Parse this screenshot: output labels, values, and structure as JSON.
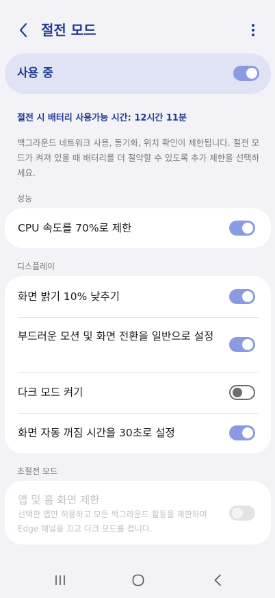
{
  "header": {
    "title": "절전 모드"
  },
  "master": {
    "label": "사용 중",
    "enabled": true
  },
  "battery_time": "절전 시 배터리 사용가능 시간: 12시간 11분",
  "description": "백그라운드 네트워크 사용, 동기화, 위치 확인이 제한됩니다. 절전 모드가 켜져 있을 때 배터리를 더 절약할 수 있도록 추가 제한을 선택하세요.",
  "sections": {
    "performance": {
      "label": "성능",
      "items": [
        {
          "label": "CPU 속도를 70%로 제한",
          "enabled": true
        }
      ]
    },
    "display": {
      "label": "디스플레이",
      "items": [
        {
          "label": "화면 밝기 10% 낮추기",
          "enabled": true
        },
        {
          "label": "부드러운 모션 및 화면 전환을 일반으로 설정",
          "enabled": true
        },
        {
          "label": "다크 모드 켜기",
          "enabled": false
        },
        {
          "label": "화면 자동 꺼짐 시간을 30초로 설정",
          "enabled": true
        }
      ]
    },
    "ultra": {
      "label": "초절전 모드",
      "items": [
        {
          "label": "앱 및 홈 화면 제한",
          "sub": "선택한 앱만 허용하고 모든 백그라운드 활동을 제한하며 Edge 패널을 끄고 다크 모드를 켭니다.",
          "enabled": false,
          "disabled": true
        }
      ]
    }
  },
  "icons": {
    "back": "chevron-left-icon",
    "more": "more-vertical-icon",
    "nav_recents": "recents-icon",
    "nav_home": "home-icon",
    "nav_back": "back-icon"
  },
  "colors": {
    "accent": "#1f3a93",
    "toggle_on": "#8a9ae3",
    "background": "#f2f2f7"
  }
}
